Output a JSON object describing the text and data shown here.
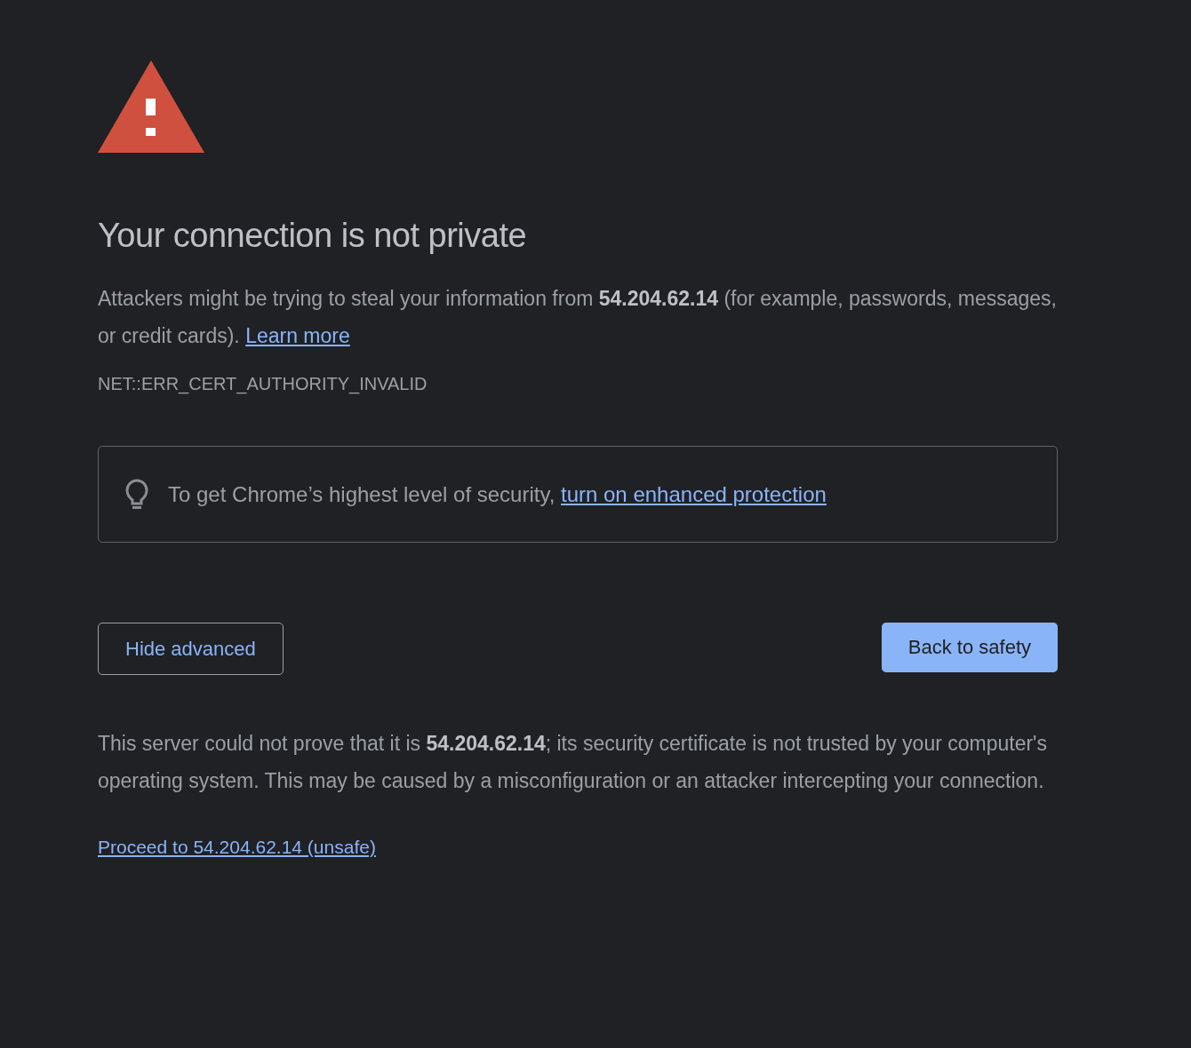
{
  "heading": "Your connection is not private",
  "intro": {
    "text": "Attackers might be trying to steal your information from **54.204.62.14** (for example, passwords, messages, or credit cards).",
    "link": "Learn more"
  },
  "error_code": "NET::ERR_CERT_AUTHORITY_INVALID",
  "tip": {
    "text": "To get Chrome’s highest level of security,",
    "link": "turn on enhanced protection"
  },
  "buttons": [
    {
      "label": "Hide advanced",
      "kind": "secondary"
    },
    {
      "label": "Back to safety",
      "kind": "primary"
    }
  ],
  "details": "This server could not prove that it is **54.204.62.14**; its security certificate is not trusted by your computer's operating system. This may be caused by a misconfiguration or an attacker intercepting your connection.",
  "proceed_link": "Proceed to 54.204.62.14 (unsafe)"
}
